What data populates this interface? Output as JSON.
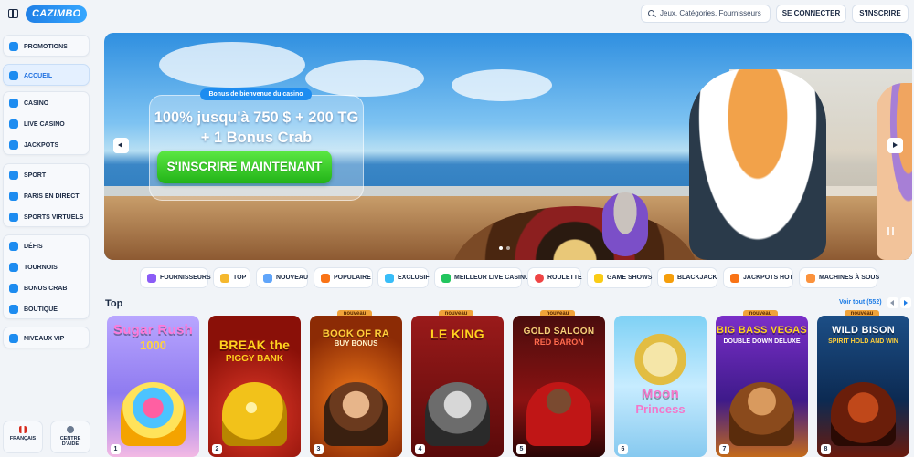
{
  "header": {
    "logo_text": "CAZIMBO",
    "search_placeholder": "Jeux, Catégories, Fournisseurs",
    "login_label": "SE CONNECTER",
    "signup_label": "S'INSCRIRE"
  },
  "sidebar": {
    "promotions": "PROMOTIONS",
    "accueil": "ACCUEIL",
    "casino": "CASINO",
    "live_casino": "LIVE CASINO",
    "jackpots": "JACKPOTS",
    "sport": "SPORT",
    "paris_direct": "PARIS EN DIRECT",
    "sports_virtuels": "SPORTS VIRTUELS",
    "defis": "DÉFIS",
    "tournois": "TOURNOIS",
    "bonus_crab": "BONUS CRAB",
    "boutique": "BOUTIQUE",
    "niveaux_vip": "NIVEAUX VIP",
    "language": "FRANÇAIS",
    "help_line1": "CENTRE",
    "help_line2": "D'AIDE"
  },
  "hero": {
    "tag": "Bonus de bienvenue du casino",
    "title_line1": "100% jusqu'à 750 $ + 200 TG",
    "title_line2": "+ 1 Bonus Crab",
    "cta": "S'INSCRIRE MAINTENANT"
  },
  "categories": [
    "FOURNISSEURS",
    "TOP",
    "NOUVEAU",
    "POPULAIRE",
    "EXCLUSIF",
    "MEILLEUR LIVE CASINO",
    "ROULETTE",
    "GAME SHOWS",
    "BLACKJACK",
    "JACKPOTS HOT",
    "MACHINES À SOUS"
  ],
  "top_section": {
    "title": "Top",
    "see_all": "Voir tout (552)",
    "new_badge": "nouveau"
  },
  "games": [
    {
      "title": "Sugar Rush",
      "subtitle": "1000",
      "rank": "1",
      "is_new": false
    },
    {
      "title": "BREAK the",
      "subtitle": "PIGGY BANK",
      "rank": "2",
      "is_new": false
    },
    {
      "title": "BOOK OF RA",
      "subtitle": "BUY BONUS",
      "rank": "3",
      "is_new": true
    },
    {
      "title": "LE KING",
      "subtitle": "",
      "rank": "4",
      "is_new": true
    },
    {
      "title": "GOLD SALOON",
      "subtitle": "RED BARON",
      "rank": "5",
      "is_new": true
    },
    {
      "title": "Moon",
      "subtitle": "Princess",
      "rank": "6",
      "is_new": false
    },
    {
      "title": "BIG BASS VEGAS",
      "subtitle": "DOUBLE DOWN DELUXE",
      "rank": "7",
      "is_new": true
    },
    {
      "title": "WILD BISON",
      "subtitle": "SPIRIT HOLD AND WIN",
      "rank": "8",
      "is_new": true
    }
  ],
  "colors": {
    "accent": "#1d8cf0",
    "cta_green": "#22b318",
    "new_badge": "#f0a33a",
    "page_bg": "#f1f4f8"
  }
}
